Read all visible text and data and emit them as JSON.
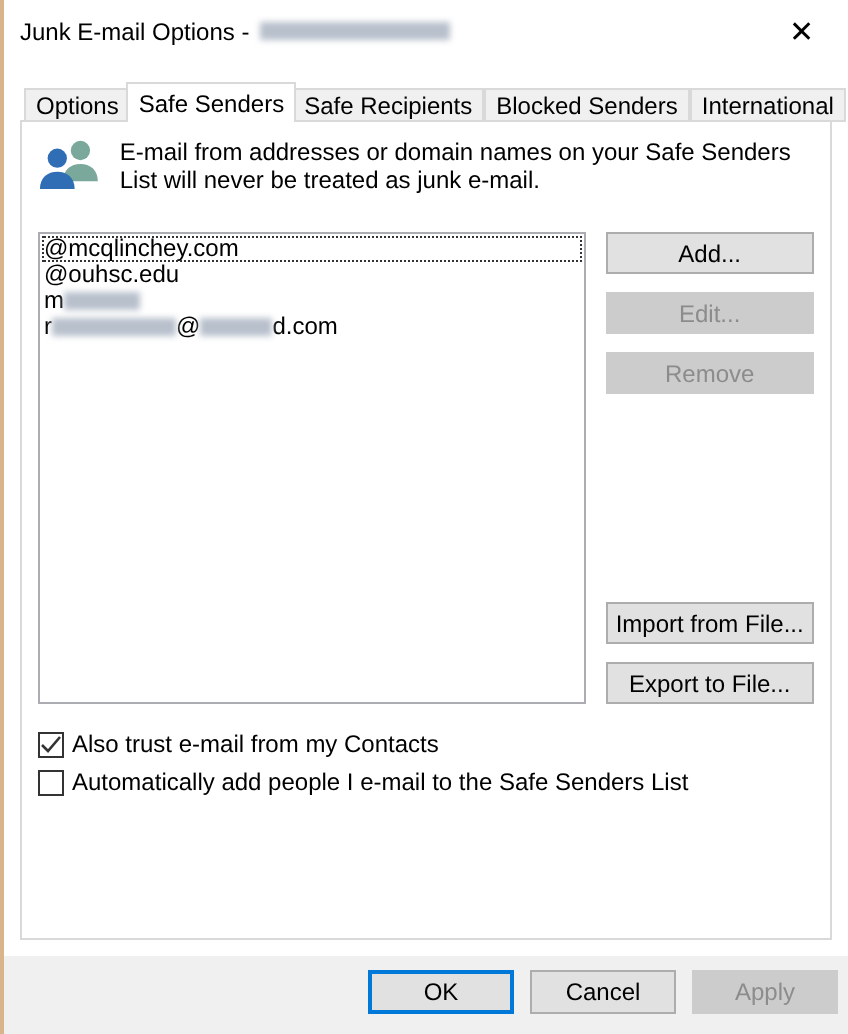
{
  "window": {
    "title": "Junk E-mail Options - ",
    "title_redacted": true,
    "close": "✕"
  },
  "tabs": [
    {
      "label": "Options",
      "selected": false
    },
    {
      "label": "Safe Senders",
      "selected": true
    },
    {
      "label": "Safe Recipients",
      "selected": false
    },
    {
      "label": "Blocked Senders",
      "selected": false
    },
    {
      "label": "International",
      "selected": false
    }
  ],
  "description": "E-mail from addresses or domain names on your Safe Senders List will never be treated as junk e-mail.",
  "senders": [
    {
      "selected": true,
      "parts": [
        {
          "kind": "text",
          "text": "@mcqlinchey.com"
        }
      ]
    },
    {
      "selected": false,
      "parts": [
        {
          "kind": "text",
          "text": "@ouhsc.edu"
        }
      ]
    },
    {
      "selected": false,
      "parts": [
        {
          "kind": "text",
          "text": "m"
        },
        {
          "kind": "redacted"
        }
      ]
    },
    {
      "selected": false,
      "parts": [
        {
          "kind": "text",
          "text": "r"
        },
        {
          "kind": "redacted"
        },
        {
          "kind": "text",
          "text": "@"
        },
        {
          "kind": "redacted"
        },
        {
          "kind": "text",
          "text": "d.com"
        }
      ]
    }
  ],
  "side_buttons": [
    {
      "label": "Add...",
      "disabled": false
    },
    {
      "label": "Edit...",
      "disabled": true
    },
    {
      "label": "Remove",
      "disabled": true
    }
  ],
  "file_buttons": [
    {
      "label": "Import from File...",
      "disabled": false
    },
    {
      "label": "Export to File...",
      "disabled": false
    }
  ],
  "options": [
    {
      "label": "Also trust e-mail from my Contacts",
      "checked": true
    },
    {
      "label": "Automatically add people I e-mail to the Safe Senders List",
      "checked": false
    }
  ],
  "footer_buttons": [
    {
      "label": "OK",
      "disabled": false,
      "default": true
    },
    {
      "label": "Cancel",
      "disabled": false,
      "default": false
    },
    {
      "label": "Apply",
      "disabled": true,
      "default": false
    }
  ]
}
